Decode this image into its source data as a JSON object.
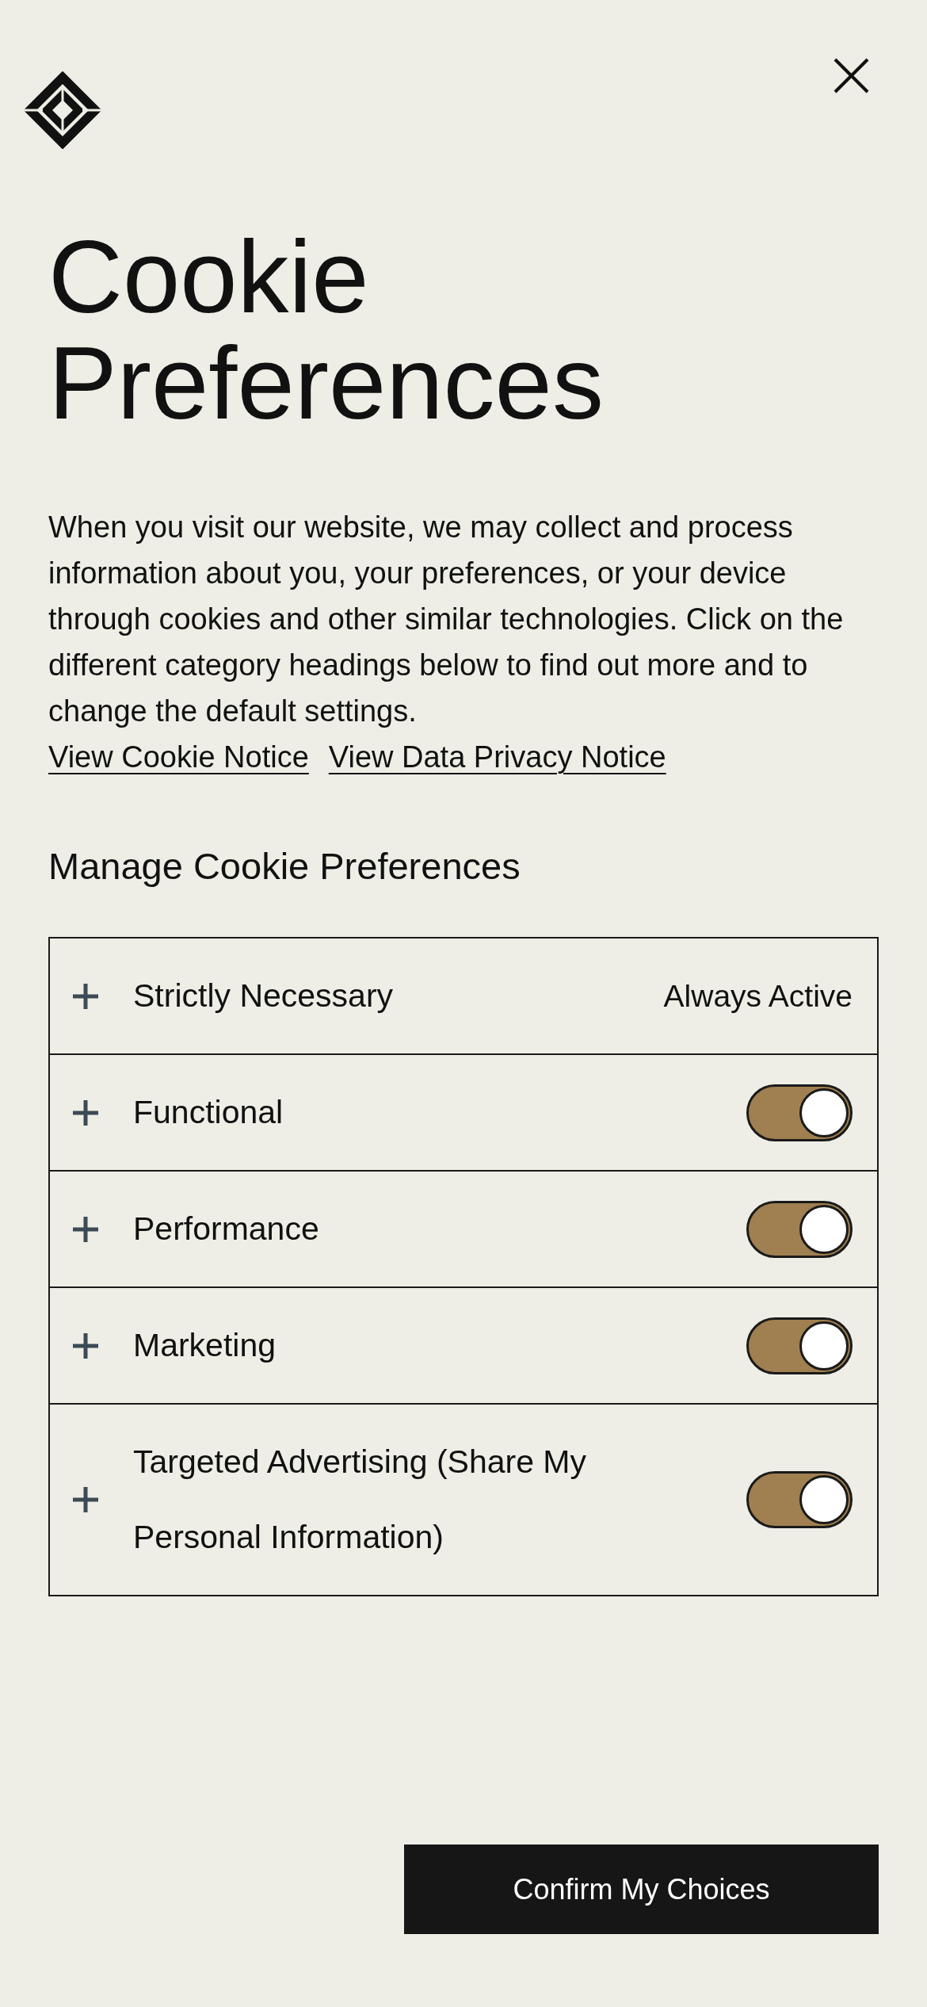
{
  "title": "Cookie Preferences",
  "description": "When you visit our website, we may collect and process information about you, your preferences, or your device through cookies and other similar technologies. Click on the different category headings below to find out more and to change the default settings.",
  "links": [
    "View Cookie Notice",
    "View Data Privacy Notice"
  ],
  "section_title": "Manage Cookie Preferences",
  "categories": [
    {
      "kind": "status",
      "label": "Strictly Necessary",
      "expanded": false,
      "status": "Always Active"
    },
    {
      "kind": "toggle",
      "label": "Functional",
      "expanded": false,
      "on": true
    },
    {
      "kind": "toggle",
      "label": "Performance",
      "expanded": false,
      "on": true
    },
    {
      "kind": "toggle",
      "label": "Marketing",
      "expanded": false,
      "on": true
    },
    {
      "kind": "toggle",
      "label": "Targeted Advertising (Share My Personal Information)",
      "expanded": false,
      "on": true
    }
  ],
  "confirm_button": "Confirm My Choices"
}
